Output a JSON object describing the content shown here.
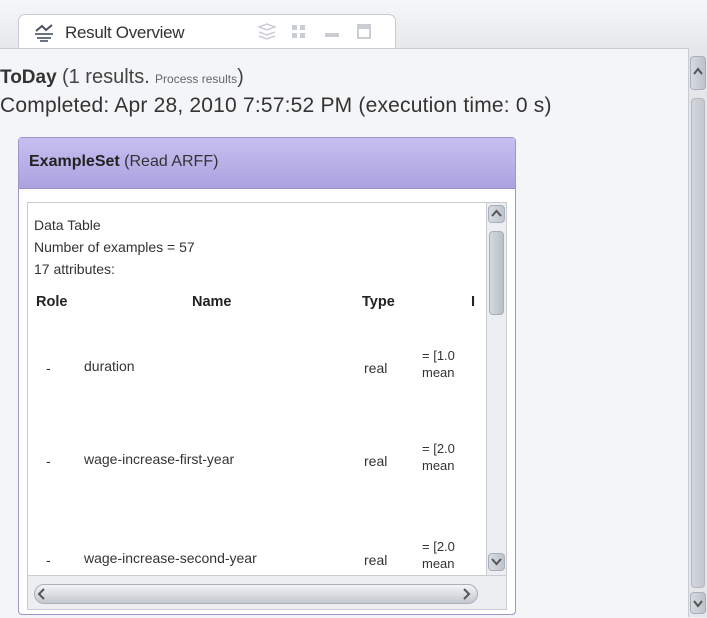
{
  "tab": {
    "label": "Result Overview",
    "icon": "result-overview-icon",
    "tools": [
      "layout-icon",
      "grid-icon",
      "minimize-icon",
      "maximize-icon"
    ]
  },
  "process": {
    "name": "ToDay",
    "count_text": "(1 results.",
    "link_text": "Process results",
    "close_paren": ")",
    "completed_text": "Completed: Apr 28, 2010 7:57:52 PM (execution time: 0 s)"
  },
  "card": {
    "title_bold": "ExampleSet",
    "title_source": "(Read ARFF)",
    "info": {
      "line1": "Data Table",
      "line2": "Number of examples = 57",
      "line3": "17 attributes:"
    },
    "columns": [
      "Role",
      "Name",
      "Type",
      "I"
    ],
    "rows": [
      {
        "role": "-",
        "name": "duration",
        "type": "real",
        "stat1": "= [1.0",
        "stat2": "mean"
      },
      {
        "role": "-",
        "name": "wage-increase-first-year",
        "type": "real",
        "stat1": "= [2.0",
        "stat2": "mean"
      },
      {
        "role": "-",
        "name": "wage-increase-second-year",
        "type": "real",
        "stat1": "= [2.0",
        "stat2": "mean"
      }
    ]
  },
  "colors": {
    "card_header": "#b9b0e8",
    "card_border": "#9f95c8",
    "background": "#f4f5f7"
  }
}
